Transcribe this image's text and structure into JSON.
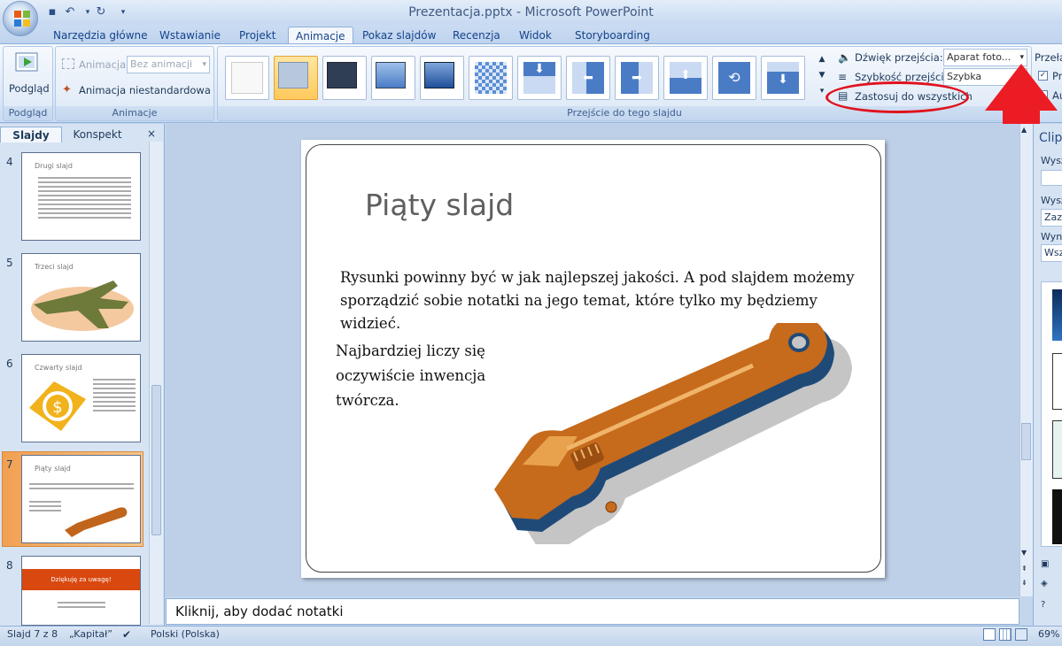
{
  "window": {
    "title": "Prezentacja.pptx - Microsoft PowerPoint"
  },
  "tabs": [
    "Narzędzia główne",
    "Wstawianie",
    "Projekt",
    "Animacje",
    "Pokaz slajdów",
    "Recenzja",
    "Widok",
    "Storyboarding"
  ],
  "active_tab": "Animacje",
  "ribbon": {
    "preview_group": {
      "button": "Podgląd",
      "label": "Podgląd"
    },
    "animations_group": {
      "animate_label": "Animacja:",
      "animate_value": "Bez animacji",
      "custom_animation": "Animacja niestandardowa",
      "label": "Animacje"
    },
    "transition_group": {
      "sound_label": "Dźwięk przejścia:",
      "sound_value": "Aparat foto...",
      "speed_label": "Szybkość przejścia:",
      "speed_value": "Szybka",
      "apply_all": "Zastosuj do wszystkich",
      "label": "Przejście do tego slajdu"
    },
    "advance_group": {
      "label": "Przełą",
      "opt1": "Pr",
      "opt2": "Au"
    }
  },
  "slides_panel": {
    "tab_slides": "Slajdy",
    "tab_outline": "Konspekt",
    "slides": [
      {
        "num": "4",
        "title": "Drugi slajd"
      },
      {
        "num": "5",
        "title": "Trzeci slajd"
      },
      {
        "num": "6",
        "title": "Czwarty slajd"
      },
      {
        "num": "7",
        "title": "Piąty slajd"
      },
      {
        "num": "8",
        "title": "Dziękuję za uwagę!"
      }
    ]
  },
  "slide": {
    "title": "Piąty slajd",
    "body": "Rysunki powinny być w jak najlepszej jakości. A pod slajdem możemy sporządzić sobie notatki na jego temat, które tylko my będziemy widzieć.",
    "left_text": "Najbardziej liczy się oczywiście inwencja twórcza."
  },
  "notes": {
    "placeholder": "Kliknij, aby dodać notatki"
  },
  "clipart_panel": {
    "title": "Clipa",
    "search_label": "Wysz",
    "search_in_label": "Wysz",
    "search_in_value": "Zazn",
    "results_label": "Wyni",
    "results_value": "Wszy"
  },
  "status": {
    "slide": "Slajd 7 z 8",
    "theme": "„Kapitał”",
    "language": "Polski (Polska)",
    "zoom": "69%"
  }
}
